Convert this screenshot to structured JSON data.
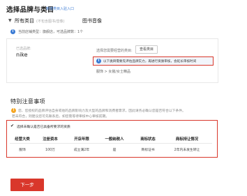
{
  "header": {
    "title": "选择品牌与类目",
    "title_link": "新增类目入驻入口"
  },
  "category": {
    "caret": "▼",
    "name": "所有类目",
    "note": "(不包含图书/音像)",
    "selected": "图书音像"
  },
  "info": {
    "icon": "i",
    "line": "当前店铺类型：旗舰店，可选品牌数：1个"
  },
  "brand": {
    "label": "已选品牌:",
    "value": "nike",
    "cert_label": "选择您需要经营的类目:",
    "cert_button": "查看类目",
    "notice_icon": "i",
    "notice": "以下类目需要先评估品牌实力，再进行资质审核，会延长审核时间",
    "breadcrumb": "服饰 > 女装/女士精品"
  },
  "special": {
    "title": "特别注意事项",
    "warn_icon": "!",
    "warn_line1": "您、您授权的品牌评估自身或他的品牌影响力及大型的品牌和消费者需求，因此请务必确认您是否符合以下条件。",
    "warn_line2": "若未符合，则建议您可先联系后，如您需等待审核中心审核前期。",
    "confirm_check": "✔",
    "confirm_label": "选择未确认是否已具备所要求的资质",
    "table": {
      "headers": [
        "经营大类",
        "注册资本",
        "开店年限",
        "一般纳税人",
        "商标状态",
        "商标持让情况"
      ],
      "row": [
        "服饰",
        "100万",
        "成立满2年",
        "是",
        "商标证书",
        "2年内未发生转让"
      ]
    }
  },
  "footer": {
    "next_button": "下一步"
  },
  "colors": {
    "accent_red": "#d9372b",
    "link_blue": "#3b7bd4",
    "warn_orange": "#f5a623"
  }
}
